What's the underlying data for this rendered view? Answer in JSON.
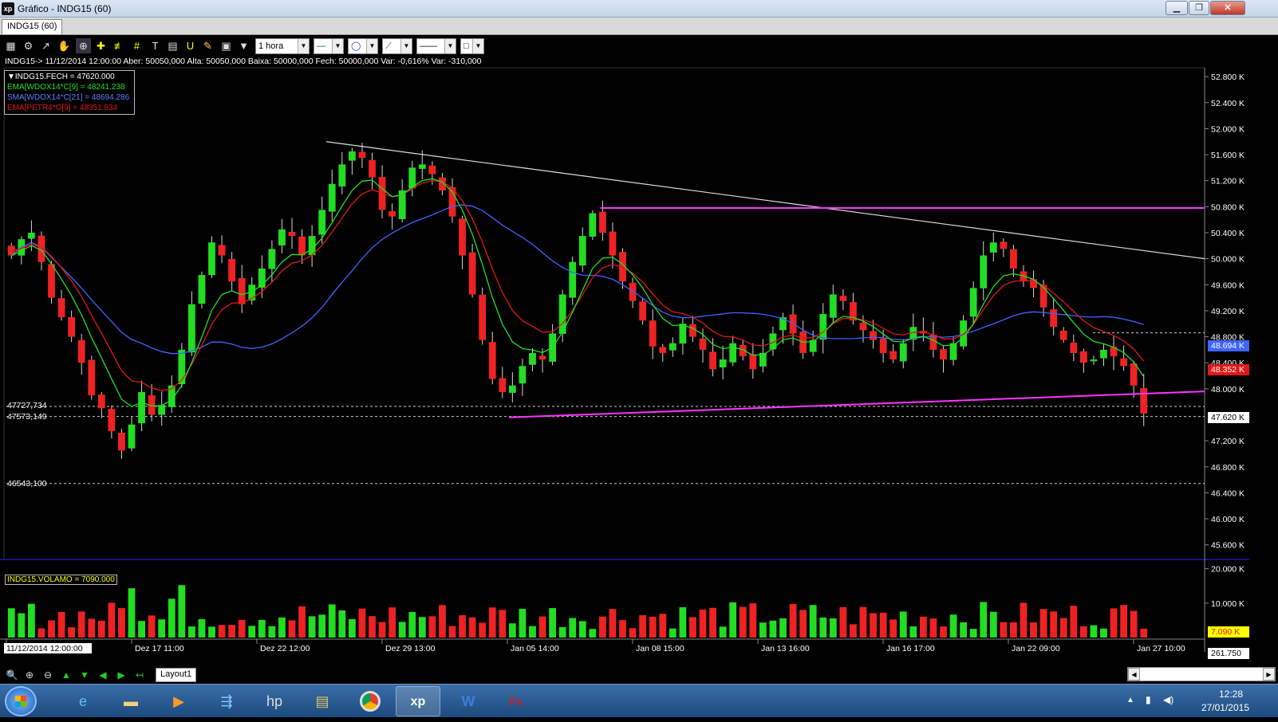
{
  "window": {
    "title": "Gráfico - INDG15 (60)",
    "app_icon": "xp",
    "buttons": [
      "minimize-icon",
      "restore-icon",
      "close-icon"
    ],
    "minimize": "▁",
    "restore": "❐",
    "close": "✕"
  },
  "tab": {
    "label": "INDG15 (60)"
  },
  "toolbar": {
    "timeframe": "1 hora",
    "icons": [
      "chart-type-icon",
      "settings-icon",
      "indicator-icon",
      "hand-icon",
      "zoom-cursor-icon",
      "crosshair-icon",
      "fibonacci-icon",
      "grid-icon",
      "text-icon",
      "calculator-icon",
      "magnet-icon",
      "brush-icon",
      "lock-icon",
      "filter-icon"
    ]
  },
  "ohlc_line": "INDG15-> 11/12/2014 12:00:00 Aber: 50050,000 Alta: 50050,000 Baixa: 50000,000 Fech: 50000,000 Var: -0,616% Var: -310,000",
  "legend": [
    {
      "text": "▼INDG15.FECH = 47620.000",
      "color": "#ffffff"
    },
    {
      "text": "EMA[WDOX14*C[9] = 48241.238",
      "color": "#22e022"
    },
    {
      "text": "SMA[WDOX14*C[21] = 48694.286",
      "color": "#3f64ff"
    },
    {
      "text": "EMA[PETR4*O[9] = 48351.834",
      "color": "#e01818"
    }
  ],
  "volume_legend": "INDG15.VOLAMO = 7090.000",
  "price_axis": [
    "52.800 K",
    "52.400 K",
    "52.000 K",
    "51.600 K",
    "51.200 K",
    "50.800 K",
    "50.400 K",
    "50.000 K",
    "49.600 K",
    "49.200 K",
    "48.800 K",
    "48.400 K",
    "48.000 K",
    "47.200 K",
    "46.800 K",
    "46.400 K",
    "46.000 K",
    "45.600 K"
  ],
  "volume_axis": [
    "20.000 K",
    "10.000 K"
  ],
  "price_tags": {
    "sma": "48.694 K",
    "ema_red": "48.352 K",
    "close": "47.620 K",
    "volume": "7.090 K",
    "volume_bottom": "261.750"
  },
  "horizontal_lines": [
    {
      "label": "47727,734",
      "value": 47727.734
    },
    {
      "label": "47573,149",
      "value": 47573.149
    },
    {
      "label": "46543,100",
      "value": 46543.1
    }
  ],
  "time_axis": [
    "11/12/2014 12:00:00",
    "Dez 17 11:00",
    "Dez 22 12:00",
    "Dez 29 13:00",
    "Jan 05 14:00",
    "Jan 08 15:00",
    "Jan 13 16:00",
    "Jan 16 17:00",
    "Jan 22 09:00",
    "Jan 27 10:00"
  ],
  "navbar": {
    "layout_tab": "Layout1",
    "icons": [
      "zoom-icon",
      "zoom-in-icon",
      "zoom-out-icon",
      "arrow-up-icon",
      "arrow-down-icon",
      "arrow-left-icon",
      "arrow-right-icon",
      "back-icon"
    ]
  },
  "taskbar": {
    "apps": [
      "internet-explorer-icon",
      "folder-icon",
      "media-player-icon",
      "remote-icon",
      "hp-icon",
      "archive-icon",
      "chrome-icon",
      "xp-icon",
      "word-icon",
      "fxpro-icon"
    ],
    "time": "12:28",
    "date": "27/01/2015"
  },
  "colors": {
    "up_candle": "#22dd22",
    "down_candle": "#ee2222",
    "ema_green": "#22e022",
    "sma_blue": "#3f64ff",
    "ema_red": "#e01818",
    "trend_white": "#dddddd",
    "support_magenta": "#ff33ff"
  },
  "chart_data": {
    "type": "candlestick",
    "symbol": "INDG15",
    "y_range": [
      45400,
      52900
    ],
    "volume_range": [
      0,
      22000
    ],
    "closes": [
      50050,
      50300,
      50400,
      49950,
      49400,
      49100,
      48800,
      48400,
      47900,
      47700,
      47350,
      47050,
      47450,
      47950,
      47600,
      47750,
      48050,
      48600,
      49300,
      49750,
      50250,
      50050,
      49650,
      49300,
      49600,
      49850,
      50150,
      50450,
      50350,
      50050,
      50350,
      50750,
      51150,
      51450,
      51650,
      51550,
      51250,
      50750,
      50650,
      51050,
      51400,
      51450,
      51300,
      51050,
      50650,
      50050,
      49450,
      48750,
      48150,
      47950,
      48050,
      48350,
      48550,
      48450,
      48850,
      49450,
      49950,
      50350,
      50700,
      50400,
      50050,
      49650,
      49350,
      49050,
      48650,
      48550,
      48700,
      49000,
      48800,
      48600,
      48300,
      48450,
      48700,
      48500,
      48300,
      48550,
      48850,
      49100,
      48850,
      48550,
      48750,
      49150,
      49450,
      49350,
      49050,
      48900,
      48750,
      48550,
      48450,
      48700,
      48950,
      48850,
      48600,
      48450,
      48700,
      49050,
      49550,
      50050,
      50250,
      50150,
      49850,
      49650,
      49550,
      49250,
      48950,
      48750,
      48550,
      48400,
      48450,
      48600,
      48500,
      48350,
      48050,
      47620
    ]
  }
}
